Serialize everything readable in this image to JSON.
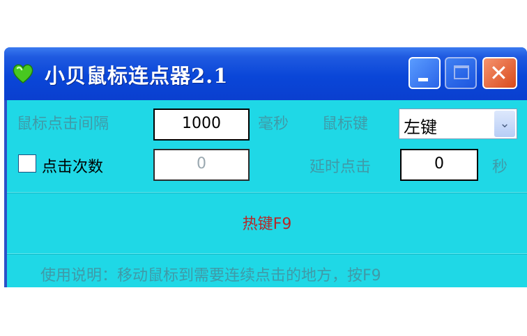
{
  "window": {
    "title": "小贝鼠标连点器2.1",
    "icon": "green-heart-icon"
  },
  "controls": {
    "minimize_icon": "minimize-icon",
    "maximize_icon": "maximize-icon",
    "close_icon": "close-icon",
    "close_glyph": "✕"
  },
  "interval": {
    "label": "鼠标点击间隔",
    "value": "1000",
    "unit": "毫秒"
  },
  "mouse_button": {
    "label": "鼠标键",
    "selected": "左键",
    "arrow": "⌄"
  },
  "click_count": {
    "label": "点击次数",
    "checked": false,
    "value": "0"
  },
  "delay": {
    "label": "延时点击",
    "value": "0",
    "unit": "秒"
  },
  "hotkey": {
    "text": "热键F9"
  },
  "usage": {
    "text": "使用说明：移动鼠标到需要连续点击的地方，按F9"
  },
  "colors": {
    "client_bg": "#1fd8e6",
    "titlebar": "#0a46d8",
    "hotkey": "#b52828",
    "disabled_text": "#3f9aa8"
  }
}
